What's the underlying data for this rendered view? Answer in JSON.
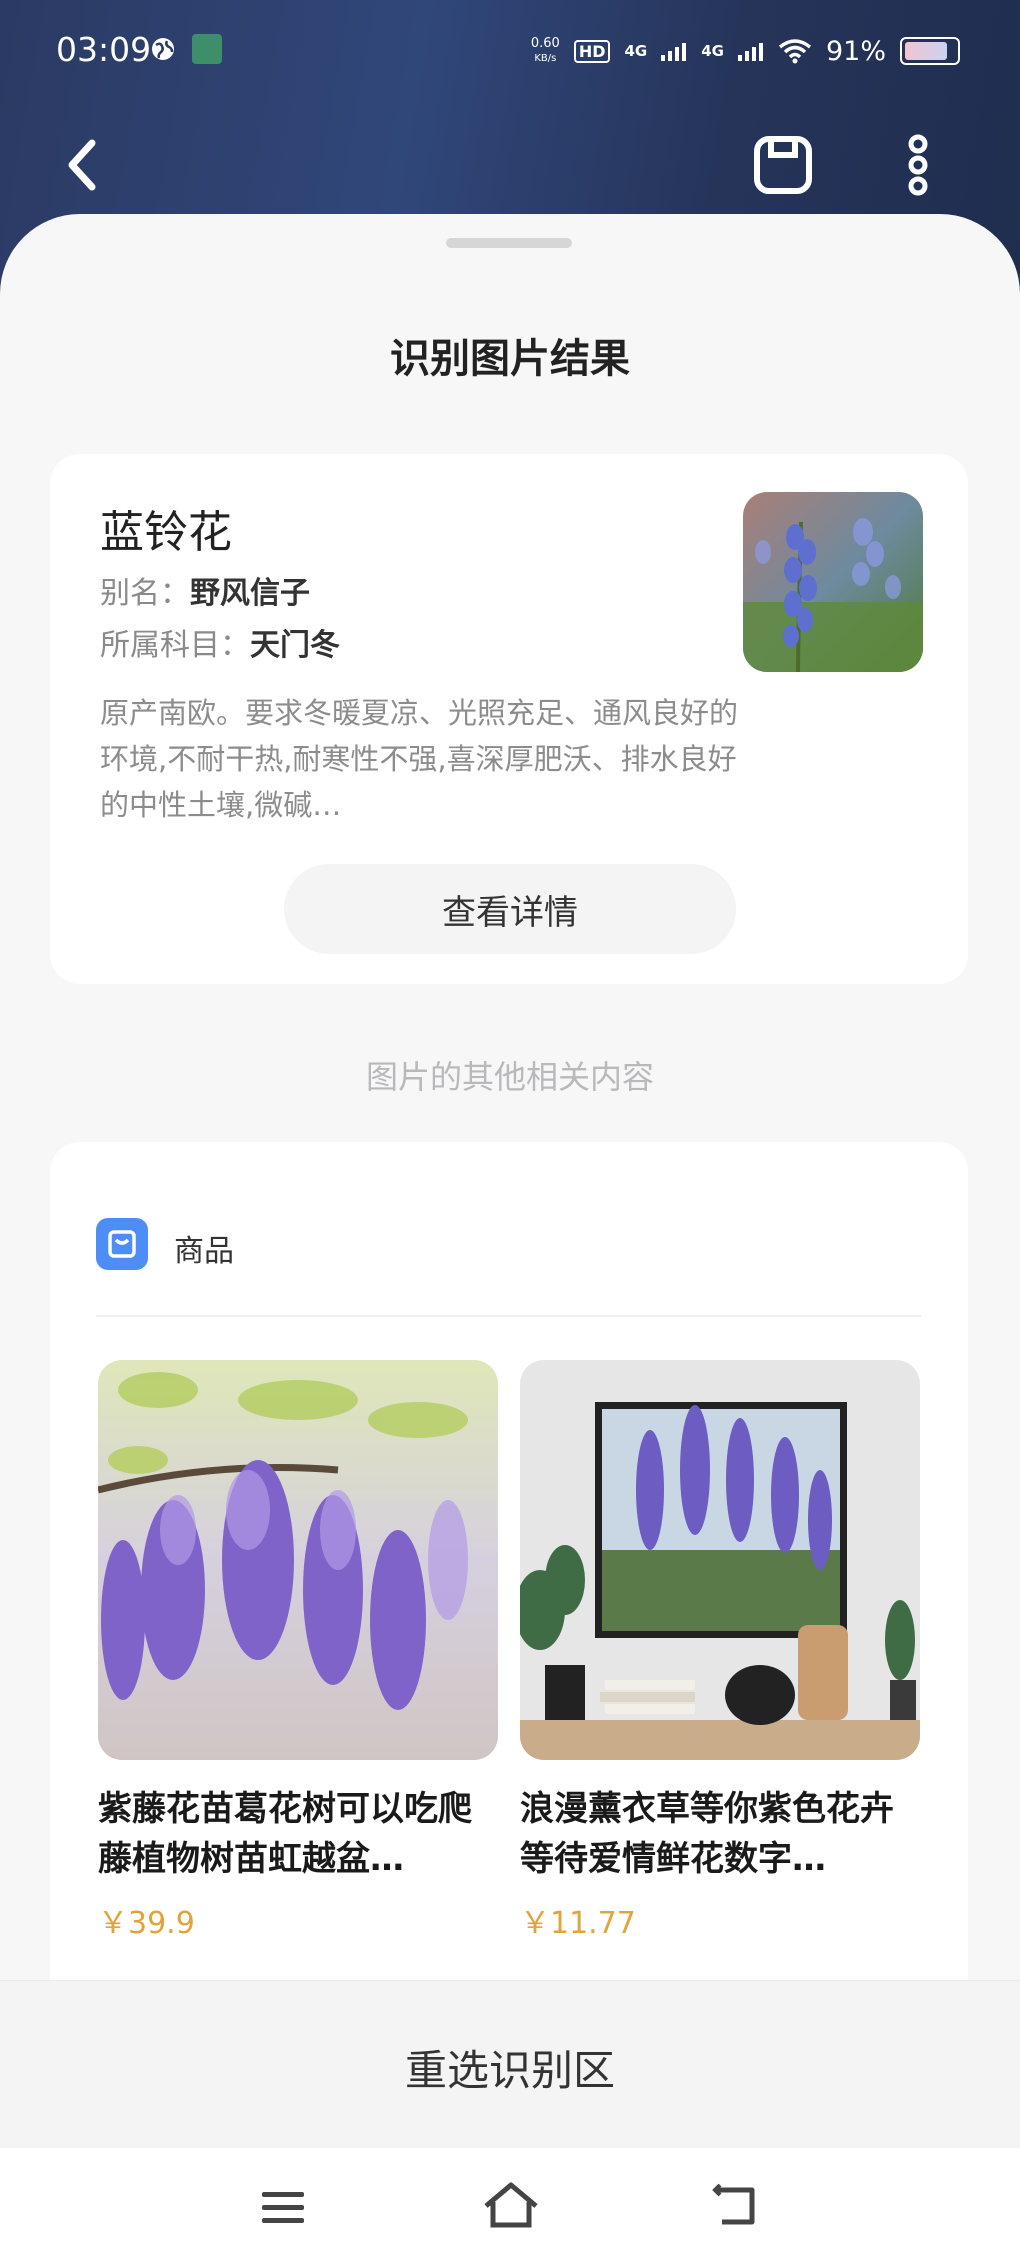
{
  "status_bar": {
    "time": "03:09",
    "net_speed_value": "0.60",
    "net_speed_unit": "KB/s",
    "hd_badge": "HD",
    "net1": "4G",
    "net2": "4G",
    "battery": "91%",
    "battery_level": 0.91
  },
  "header": {
    "back_icon": "chevron-left-icon",
    "save_icon": "save-icon",
    "more_icon": "more-vertical-icon"
  },
  "sheet": {
    "title": "识别图片结果"
  },
  "result": {
    "name": "蓝铃花",
    "alias_label": "别名：",
    "alias_value": "野风信子",
    "family_label": "所属科目：",
    "family_value": "天门冬",
    "description": "原产南欧。要求冬暖夏凉、光照充足、通风良好的环境,不耐干热,耐寒性不强,喜深厚肥沃、排水良好的中性土壤,微碱…",
    "detail_button": "查看详情"
  },
  "related": {
    "label": "图片的其他相关内容",
    "section_label": "商品",
    "section_icon": "shopping-bag-icon",
    "products": [
      {
        "title": "紫藤花苗葛花树可以吃爬藤植物树苗虹越盆…",
        "price": "￥39.9"
      },
      {
        "title": "浪漫薰衣草等你紫色花卉等待爱情鲜花数字…",
        "price": "￥11.77"
      }
    ]
  },
  "bottom": {
    "reselect": "重选识别区"
  },
  "navbar": {
    "menu_icon": "menu-icon",
    "home_icon": "home-icon",
    "back_icon": "back-icon"
  },
  "colors": {
    "accent_blue": "#4d8df5",
    "price_orange": "#e2a33a",
    "header_navy": "#2b3a63"
  }
}
